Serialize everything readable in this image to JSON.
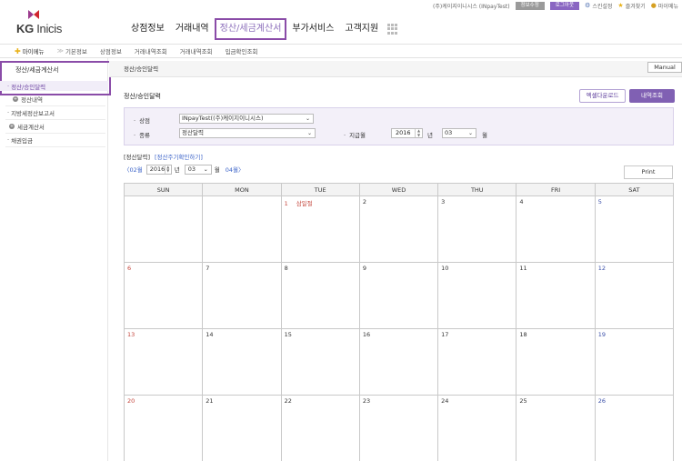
{
  "util": {
    "company": "(주)케이지이니시스 (INpayTest)",
    "btn_info": "정보수정",
    "btn_logout": "로그아웃",
    "settings": "스킨설정",
    "favorites": "즐겨찾기",
    "mypage": "마이메뉴"
  },
  "logo": {
    "kg": "KG",
    "inicis": "Inicis"
  },
  "nav": [
    "상점정보",
    "거래내역",
    "정산/세금계산서",
    "부가서비스",
    "고객지원"
  ],
  "subnav": {
    "mymenu": "마이메뉴",
    "basic": "기본정보",
    "items": [
      "상점정보",
      "거래내역조회",
      "거래내역조회",
      "입금확인조회"
    ]
  },
  "sidebar": {
    "title": "정산/세금계산서",
    "items": [
      "정산/승인달력",
      "정산내역",
      "지방세정산보고서",
      "세금계산서",
      "채권입금"
    ]
  },
  "breadcrumb": "정산/승인달력",
  "manual": "Manual",
  "page_title": "정산/승인달력",
  "btn_excel": "엑셀다운로드",
  "btn_search": "내역조회",
  "filter": {
    "store_label": "상점",
    "store_value": "INpayTest((주)케이지이니시스)",
    "type_label": "종류",
    "type_value": "정산달력",
    "paymonth_label": "지급월",
    "year": "2016",
    "year_unit": "년",
    "month": "03",
    "month_unit": "월"
  },
  "tabs": {
    "current": "[정산달력]",
    "link": "[정산주기확인하기]"
  },
  "month_nav": {
    "prev": "〈02월",
    "year": "2016",
    "year_unit": "년",
    "month": "03",
    "month_unit": "월",
    "next": "04월〉"
  },
  "print": "Print",
  "calendar": {
    "headers": [
      "SUN",
      "MON",
      "TUE",
      "WED",
      "THU",
      "FRI",
      "SAT"
    ],
    "holiday_label": "삼일절",
    "weeks": [
      [
        "",
        "",
        "1",
        "2",
        "3",
        "4",
        "5"
      ],
      [
        "6",
        "7",
        "8",
        "9",
        "10",
        "11",
        "12"
      ],
      [
        "13",
        "14",
        "15",
        "16",
        "17",
        "18",
        "19"
      ],
      [
        "20",
        "21",
        "22",
        "23",
        "24",
        "25",
        "26"
      ]
    ]
  },
  "colors": {
    "accent": "#8060b3",
    "highlight_border": "#8a4ca8",
    "link": "#3a62c8",
    "sunday": "#c4453b",
    "saturday": "#3a4fa8"
  }
}
